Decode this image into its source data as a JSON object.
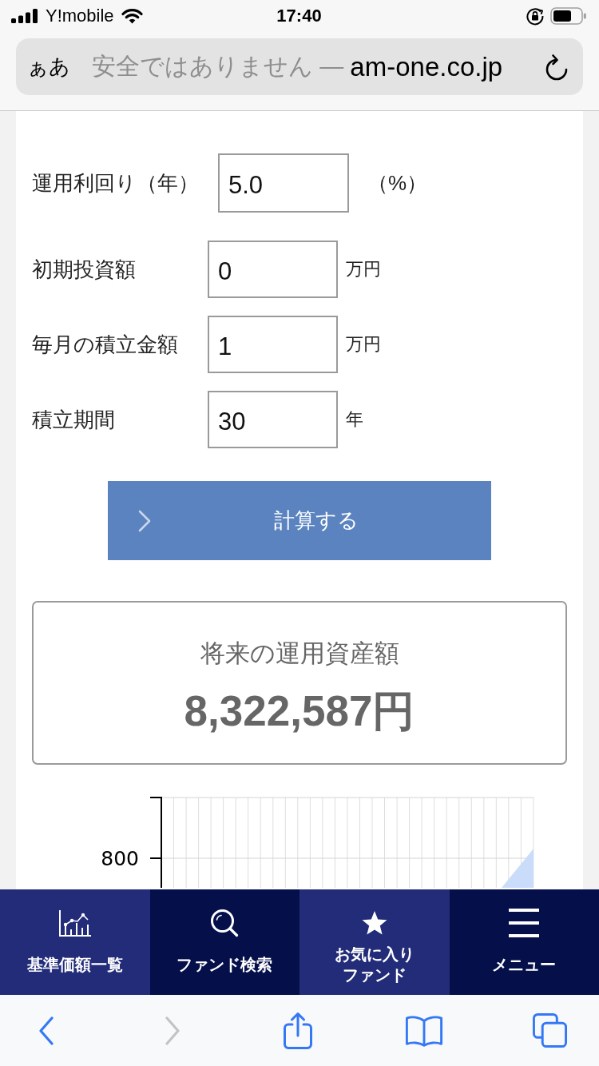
{
  "status_bar": {
    "carrier": "Y!mobile",
    "time": "17:40"
  },
  "address_bar": {
    "text_size_button": "ぁあ",
    "security_notice": "安全ではありません —",
    "domain": "am-one.co.jp"
  },
  "form": {
    "fields": [
      {
        "kind": "rate",
        "label": "運用利回り（年）",
        "value": "5.0",
        "unit": "（%）"
      },
      {
        "kind": "amount",
        "label": "初期投資額",
        "value": "0",
        "unit": "万円"
      },
      {
        "kind": "amount",
        "label": "毎月の積立金額",
        "value": "1",
        "unit": "万円"
      },
      {
        "kind": "amount",
        "label": "積立期間",
        "value": "30",
        "unit": "年"
      }
    ],
    "submit_button": "計算する"
  },
  "result": {
    "title": "将来の運用資産額",
    "amount": "8,322,587円"
  },
  "chart": {
    "y_tick_label": "800"
  },
  "bottom_nav": [
    {
      "kind": "prices",
      "label": "基準価額一覧"
    },
    {
      "kind": "search",
      "label": "ファンド検索"
    },
    {
      "kind": "favorites",
      "label": "お気に入りファンド"
    },
    {
      "kind": "menu",
      "label": "メニュー"
    }
  ],
  "toolbar": [
    {
      "kind": "back",
      "disabled": false
    },
    {
      "kind": "forward",
      "disabled": true
    },
    {
      "kind": "share",
      "disabled": false
    },
    {
      "kind": "bookmarks",
      "disabled": false
    },
    {
      "kind": "tabs",
      "disabled": false
    }
  ]
}
